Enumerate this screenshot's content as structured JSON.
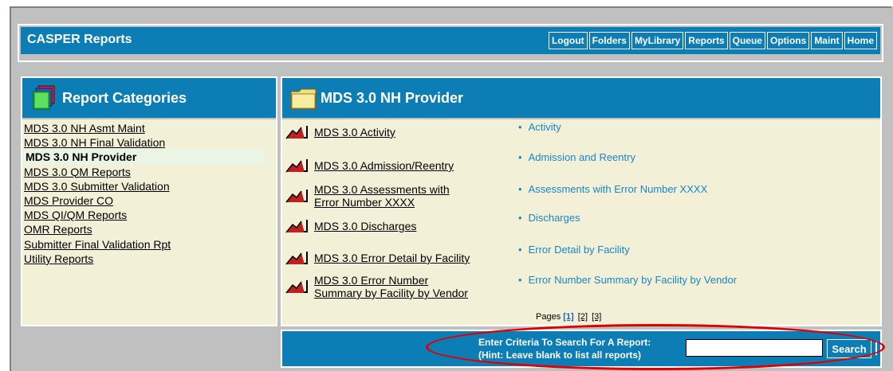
{
  "app": {
    "title": "CASPER Reports"
  },
  "nav": [
    {
      "label": "Logout"
    },
    {
      "label": "Folders"
    },
    {
      "label": "MyLibrary"
    },
    {
      "label": "Reports"
    },
    {
      "label": "Queue"
    },
    {
      "label": "Options"
    },
    {
      "label": "Maint"
    },
    {
      "label": "Home"
    }
  ],
  "categories": {
    "title": "Report Categories",
    "items": [
      {
        "label": "MDS 3.0 NH Asmt Maint"
      },
      {
        "label": "MDS 3.0 NH Final Validation"
      },
      {
        "label": "MDS 3.0 NH Provider",
        "active": true
      },
      {
        "label": "MDS 3.0 QM Reports"
      },
      {
        "label": "MDS 3.0 Submitter Validation"
      },
      {
        "label": "MDS Provider CO"
      },
      {
        "label": "MDS QI/QM Reports"
      },
      {
        "label": "OMR Reports"
      },
      {
        "label": "Submitter Final Validation Rpt"
      },
      {
        "label": "Utility Reports"
      }
    ]
  },
  "provider": {
    "title": "MDS 3.0 NH Provider",
    "reports": [
      {
        "line1": "MDS 3.0 Activity",
        "line2": ""
      },
      {
        "line1": "MDS 3.0 Admission/Reentry",
        "line2": ""
      },
      {
        "line1": "MDS 3.0 Assessments with",
        "line2": "Error Number XXXX"
      },
      {
        "line1": "MDS 3.0 Discharges",
        "line2": ""
      },
      {
        "line1": "MDS 3.0 Error Detail by Facility",
        "line2": ""
      },
      {
        "line1": "MDS 3.0 Error Number",
        "line2": "Summary by Facility by Vendor"
      }
    ],
    "bullets": [
      {
        "label": "Activity"
      },
      {
        "label": "Admission and Reentry"
      },
      {
        "label": "Assessments with Error Number XXXX"
      },
      {
        "label": "Discharges"
      },
      {
        "label": "Error Detail by Facility"
      },
      {
        "label": "Error Number Summary by Facility by Vendor"
      }
    ],
    "pages_label": "Pages",
    "pages": [
      "[1]",
      "[2]",
      "[3]"
    ],
    "current_page": 1
  },
  "search": {
    "label_line1": "Enter Criteria To Search For A Report:",
    "label_line2": "(Hint: Leave blank to list all reports)",
    "value": "",
    "button": "Search"
  },
  "colors": {
    "header_blue": "#0c7db5",
    "panel_bg": "#f3f0d8",
    "link_blue": "#1a85c5",
    "highlight_red": "#e00000"
  },
  "icons": {
    "category_header": "stacked-folders-icon",
    "provider_header": "folder-icon",
    "report": "report-chart-icon"
  }
}
